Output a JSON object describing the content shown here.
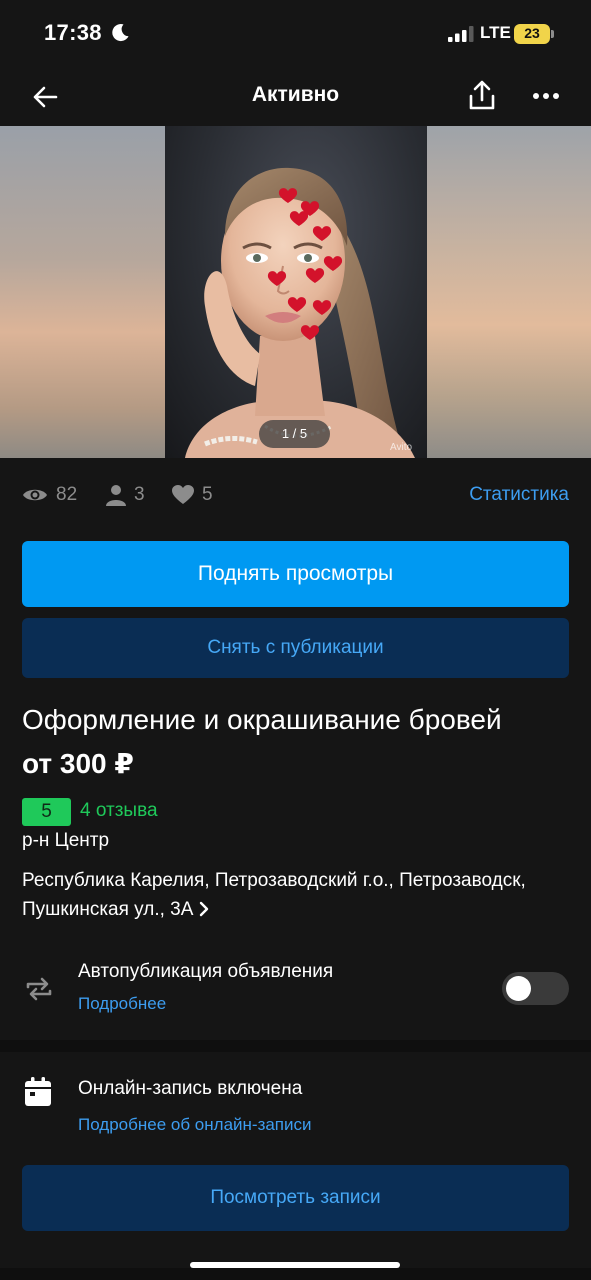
{
  "status_bar": {
    "time": "17:38",
    "network": "LTE",
    "battery": "23"
  },
  "nav": {
    "title": "Активно"
  },
  "gallery": {
    "counter": "1 / 5",
    "watermark": "Avito"
  },
  "stats": {
    "views": "82",
    "contacts": "3",
    "favorites": "5",
    "link": "Статистика"
  },
  "actions": {
    "promote": "Поднять просмотры",
    "unpublish": "Снять с публикации"
  },
  "listing": {
    "title": "Оформление и окрашивание бровей",
    "price": "от 300 ₽",
    "rating": "5",
    "reviews": "4 отзыва",
    "district": "р-н Центр",
    "address": "Республика Карелия, Петрозаводский г.о., Петрозаводск, Пушкинская ул., 3А"
  },
  "autopublish": {
    "title": "Автопубликация объявления",
    "link": "Подробнее",
    "enabled": false
  },
  "online_booking": {
    "title": "Онлайн-запись включена",
    "link": "Подробнее об онлайн-записи",
    "button": "Посмотреть записи"
  },
  "colors": {
    "background": "#151515",
    "accent_blue": "#0099f2",
    "link_blue": "#3d9df0",
    "secondary_button": "#0a2d54",
    "rating_green": "#1fc95a"
  },
  "icons": [
    "moon-icon",
    "signal-icon",
    "back-arrow-icon",
    "share-icon",
    "more-icon",
    "eye-icon",
    "person-icon",
    "heart-icon",
    "repeat-icon",
    "calendar-icon",
    "chevron-right-icon"
  ]
}
